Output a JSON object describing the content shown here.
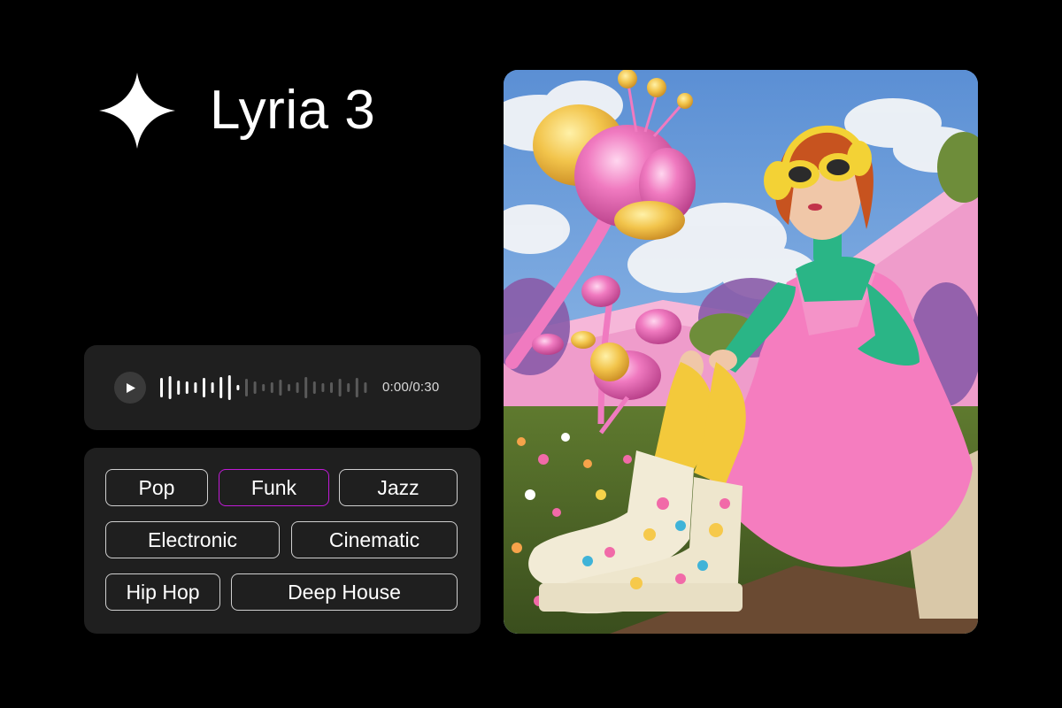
{
  "brand": {
    "title": "Lyria 3",
    "logo_icon": "sparkle-star-icon"
  },
  "player": {
    "play_icon": "play-icon",
    "time": "0:00/0:30",
    "progress": 0
  },
  "genres": [
    {
      "label": "Pop",
      "selected": false
    },
    {
      "label": "Funk",
      "selected": true
    },
    {
      "label": "Jazz",
      "selected": false
    },
    {
      "label": "Electronic",
      "selected": false
    },
    {
      "label": "Cinematic",
      "selected": false
    },
    {
      "label": "Hip Hop",
      "selected": false
    },
    {
      "label": "Deep House",
      "selected": false
    }
  ],
  "colors": {
    "background": "#000000",
    "card": "#1f1f1f",
    "chip_border": "#cfcfcf",
    "selected_accent": "#c01bd6"
  }
}
